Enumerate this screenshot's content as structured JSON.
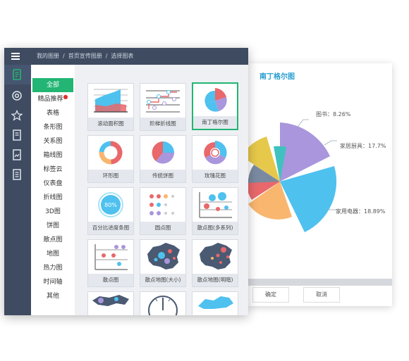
{
  "breadcrumb": [
    "我的图册",
    "首页宣传图册",
    "选择图表"
  ],
  "categories": [
    {
      "label": "全部",
      "active": true
    },
    {
      "label": "精品推荐",
      "badge": true
    },
    {
      "label": "表格"
    },
    {
      "label": "条形图"
    },
    {
      "label": "关系图"
    },
    {
      "label": "箱线图"
    },
    {
      "label": "标签云"
    },
    {
      "label": "仪表盘"
    },
    {
      "label": "折线图"
    },
    {
      "label": "3D图"
    },
    {
      "label": "饼图"
    },
    {
      "label": "散点图"
    },
    {
      "label": "地图"
    },
    {
      "label": "热力图"
    },
    {
      "label": "时间轴"
    },
    {
      "label": "其他"
    }
  ],
  "cards": [
    {
      "label": "滚动面积图",
      "icon": "area-chart-icon"
    },
    {
      "label": "阶梯折线图",
      "icon": "step-line-chart-icon"
    },
    {
      "label": "南丁格尔图",
      "icon": "nightingale-chart-icon",
      "selected": true
    },
    {
      "label": "环形图",
      "icon": "ring-chart-icon"
    },
    {
      "label": "传统饼图",
      "icon": "pie-chart-icon"
    },
    {
      "label": "玫瑰花图",
      "icon": "rose-chart-icon"
    },
    {
      "label": "百分比进度条图",
      "icon": "percent-progress-icon",
      "value_text": "80%"
    },
    {
      "label": "圆点图",
      "icon": "dot-chart-icon"
    },
    {
      "label": "散点图(多系列)",
      "icon": "multi-scatter-icon"
    },
    {
      "label": "散点图",
      "icon": "scatter-chart-icon"
    },
    {
      "label": "散点地图(大小)",
      "icon": "scatter-map-size-icon"
    },
    {
      "label": "散点地图(明暗)",
      "icon": "scatter-map-shade-icon"
    },
    {
      "label": "",
      "icon": "map-icon"
    },
    {
      "label": "",
      "icon": "gauge-icon"
    },
    {
      "label": "",
      "icon": "map-icon"
    }
  ],
  "preview": {
    "title": "南丁格尔图",
    "labels": [
      "图书：8.26%",
      "家居厨具：17.7%",
      "家用电器：18.89%"
    ],
    "confirm_label": "确定",
    "cancel_label": "取消"
  },
  "colors": {
    "accent": "#22b573",
    "sidebar": "#3e4b61",
    "pie": [
      "#a996dc",
      "#4ec1ef",
      "#f9b66f",
      "#e8686b",
      "#7a8aa0",
      "#e6c84a",
      "#3fc2bf"
    ]
  }
}
